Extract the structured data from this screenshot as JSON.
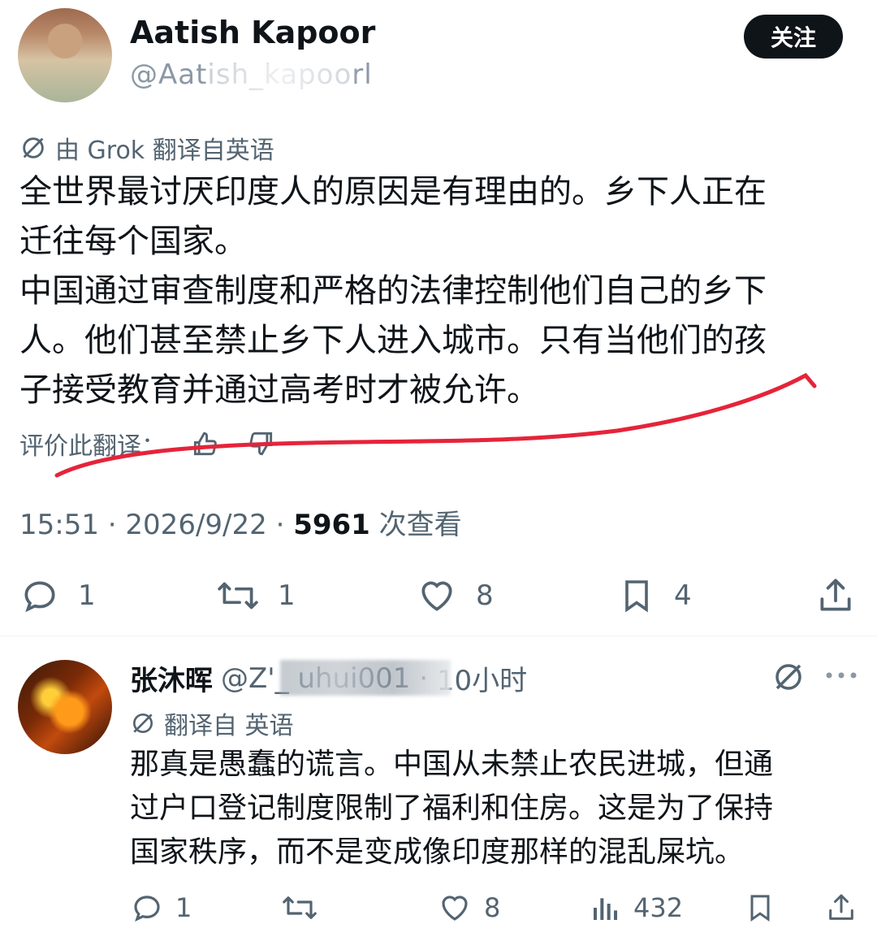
{
  "post": {
    "author_name": "Aatish Kapoor",
    "author_handle": "@Aatish_kapoorl",
    "follow_label": "关注",
    "translated_label": "由 Grok 翻译自英语",
    "text_lines": [
      "全世界最讨厌印度人的原因是有理由的。乡下人正在",
      "迁往每个国家。",
      "中国通过审查制度和严格的法律控制他们自己的乡下",
      "人。他们甚至禁止乡下人进入城市。只有当他们的孩",
      "子接受教育并通过高考时才被允许。"
    ],
    "rate_label": "评价此翻译：",
    "time": "15:51",
    "date": "2026/9/22",
    "views": "5961",
    "views_label": "次查看",
    "replies": "1",
    "reposts": "1",
    "likes": "8",
    "bookmarks": "4"
  },
  "reply": {
    "name": "张沐晖",
    "handle": "@Z'_ uhui001",
    "time": "10小时",
    "translated_label": "翻译自 英语",
    "text_lines": [
      "那真是愚蠢的谎言。中国从未禁止农民进城，但通",
      "过户口登记制度限制了福利和住房。这是为了保持",
      "国家秩序，而不是变成像印度那样的混乱屎坑。"
    ],
    "replies": "1",
    "likes": "8",
    "views": "432"
  },
  "icons": {
    "translate": "translate-icon",
    "thumb_up": "thumbs-up-icon",
    "thumb_down": "thumbs-down-icon",
    "reply": "reply-icon",
    "repost": "repost-icon",
    "like": "heart-icon",
    "bookmark": "bookmark-icon",
    "share": "share-icon",
    "views": "views-icon",
    "more": "more-icon"
  },
  "colors": {
    "text": "#0f1419",
    "muted": "#536471",
    "annotation": "#e5243a"
  }
}
